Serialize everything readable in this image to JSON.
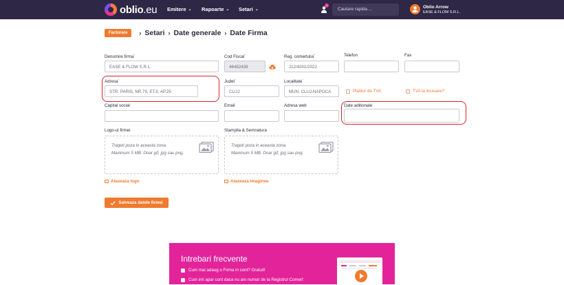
{
  "header": {
    "logo_main": "oblio",
    "logo_suffix": ".eu",
    "nav": [
      {
        "label": "Emitere"
      },
      {
        "label": "Rapoarte"
      },
      {
        "label": "Setari"
      }
    ],
    "notification_count": "1",
    "search_placeholder": "Cautare rapida ...",
    "user_name": "Oblio Arrow",
    "user_company": "EASE & FLOW S.R.L."
  },
  "breadcrumb": {
    "badge": "Facturare",
    "items": [
      "Setari",
      "Date generale",
      "Date Firma"
    ],
    "separator": "›"
  },
  "form": {
    "denumire_label": "Denumire firma",
    "denumire_value": "EASE & FLOW S.R.L.",
    "cod_fiscal_label": "Cod Fiscal",
    "cod_fiscal_value": "46482439",
    "reg_label": "Reg. comertului",
    "reg_value": "J12/4301/2022",
    "telefon_label": "Telefon",
    "telefon_value": "",
    "fax_label": "Fax",
    "fax_value": "",
    "adresa_label": "Adresa",
    "adresa_value": "STR. PARIS, NR.79, ET.II, AP.25",
    "judet_label": "Judet",
    "judet_value": "CLUJ",
    "localitate_label": "Localitate",
    "localitate_value": "MUN. CLUJ-NAPOCA",
    "platitor_tva": "Platitor de TVA",
    "tva_incasare": "TVA la incasare?",
    "capital_label": "Capital social",
    "email_label": "Email",
    "web_label": "Adresa web",
    "date_aditionale_label": "Date aditionale",
    "required_mark": "*"
  },
  "uploads": {
    "logo_title": "Logo-ul firmei",
    "stampila_title": "Stampila & Semnatura",
    "drop_line1": "Trageti poza in aceasta zona.",
    "drop_line2": "Maximum 5 MB. Doar gif, jpg sau png.",
    "attach_logo": "Ataseaza logo",
    "attach_image": "Ataseaza imaginea"
  },
  "save_button": "Salveaza datele firmei",
  "faq": {
    "title": "Intrebari frecvente",
    "questions": [
      "Cum mai adaug o Firma in cont? Gratuit!",
      "Cum imi apar cont daca nu am numar de la Registrul Comert"
    ]
  },
  "colors": {
    "topbar": "#2e2746",
    "accent": "#f07a2e",
    "faq_bg": "#e3239a",
    "highlight_ring": "#d8232a"
  }
}
